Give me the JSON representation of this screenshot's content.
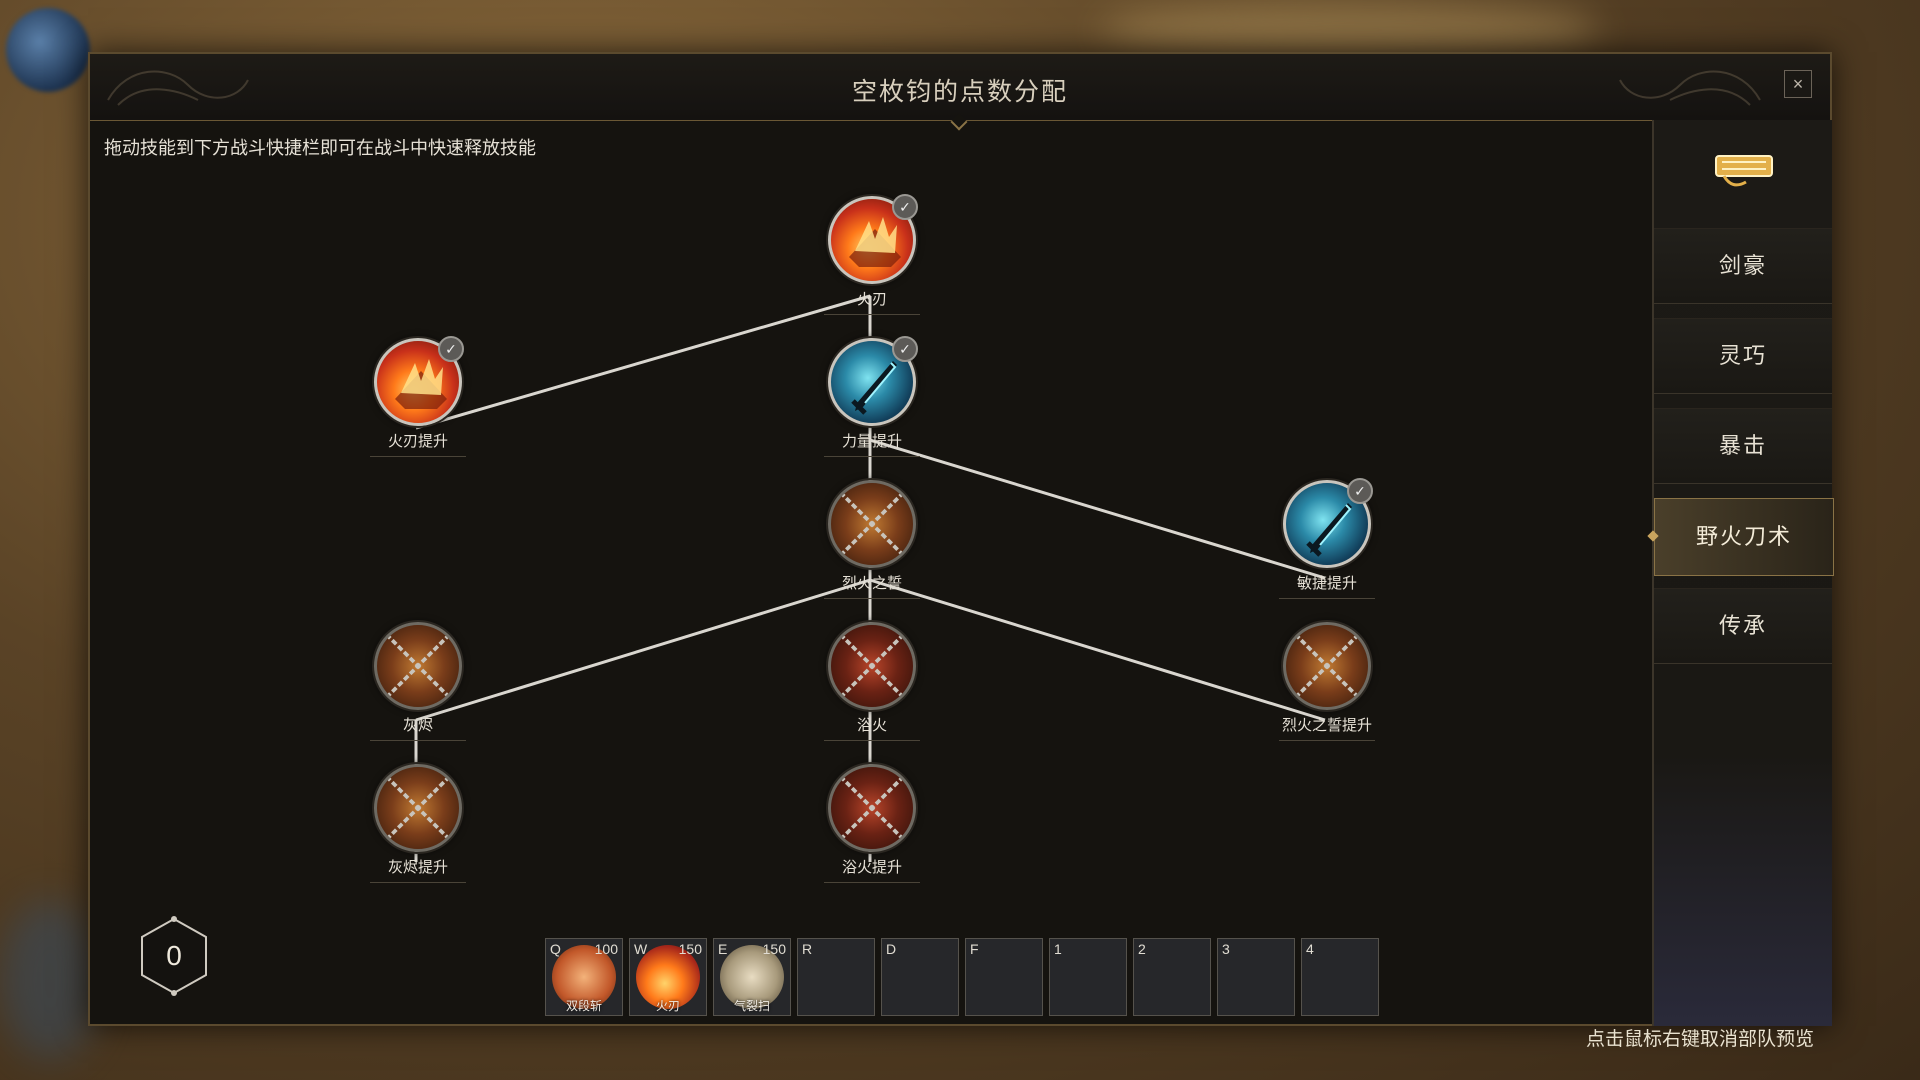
{
  "dialog": {
    "title": "空枚钧的点数分配",
    "close_label": "×",
    "hint": "拖动技能到下方战斗快捷栏即可在战斗中快速释放技能"
  },
  "skill_tree": {
    "nodes": [
      {
        "id": "huoren",
        "label": "火刃",
        "style": "fire",
        "learned": true
      },
      {
        "id": "huoren_up",
        "label": "火刃提升",
        "style": "fire",
        "learned": true
      },
      {
        "id": "liliang_up",
        "label": "力量提升",
        "style": "ice",
        "learned": true
      },
      {
        "id": "minjie_up",
        "label": "敏捷提升",
        "style": "ice",
        "learned": true
      },
      {
        "id": "liehuo_shi",
        "label": "烈火之誓",
        "style": "locked-a",
        "learned": false
      },
      {
        "id": "huijin",
        "label": "灰烬",
        "style": "locked-a",
        "learned": false
      },
      {
        "id": "yuhuo",
        "label": "浴火",
        "style": "locked-b",
        "learned": false
      },
      {
        "id": "liehuo_shi_up",
        "label": "烈火之誓提升",
        "style": "locked-a",
        "learned": false
      },
      {
        "id": "huijin_up",
        "label": "灰烬提升",
        "style": "locked-a",
        "learned": false
      },
      {
        "id": "yuhuo_up",
        "label": "浴火提升",
        "style": "locked-b",
        "learned": false
      }
    ],
    "check_glyph": "✓"
  },
  "points": {
    "remaining": "0"
  },
  "hotbar": {
    "slots": [
      {
        "key": "Q",
        "cost": "100",
        "name": "双段斩",
        "icon": "slash-skill-icon"
      },
      {
        "key": "W",
        "cost": "150",
        "name": "火刃",
        "icon": "fire-blade-icon"
      },
      {
        "key": "E",
        "cost": "150",
        "name": "气裂扫",
        "icon": "sweep-skill-icon"
      },
      {
        "key": "R",
        "cost": "",
        "name": ""
      },
      {
        "key": "D",
        "cost": "",
        "name": ""
      },
      {
        "key": "F",
        "cost": "",
        "name": ""
      },
      {
        "key": "1",
        "cost": "",
        "name": ""
      },
      {
        "key": "2",
        "cost": "",
        "name": ""
      },
      {
        "key": "3",
        "cost": "",
        "name": ""
      },
      {
        "key": "4",
        "cost": "",
        "name": ""
      }
    ]
  },
  "sidebar": {
    "icon": "scroll-icon",
    "tabs": [
      {
        "label": "剑豪",
        "active": false
      },
      {
        "label": "灵巧",
        "active": false
      },
      {
        "label": "暴击",
        "active": false
      },
      {
        "label": "野火刀术",
        "active": true
      },
      {
        "label": "传承",
        "active": false
      }
    ]
  },
  "footer": {
    "hint": "点击鼠标右键取消部队预览"
  },
  "colors": {
    "accent_gold": "#c9a45e",
    "link_line": "#d9d6cf",
    "panel_bg": "#15130f"
  }
}
